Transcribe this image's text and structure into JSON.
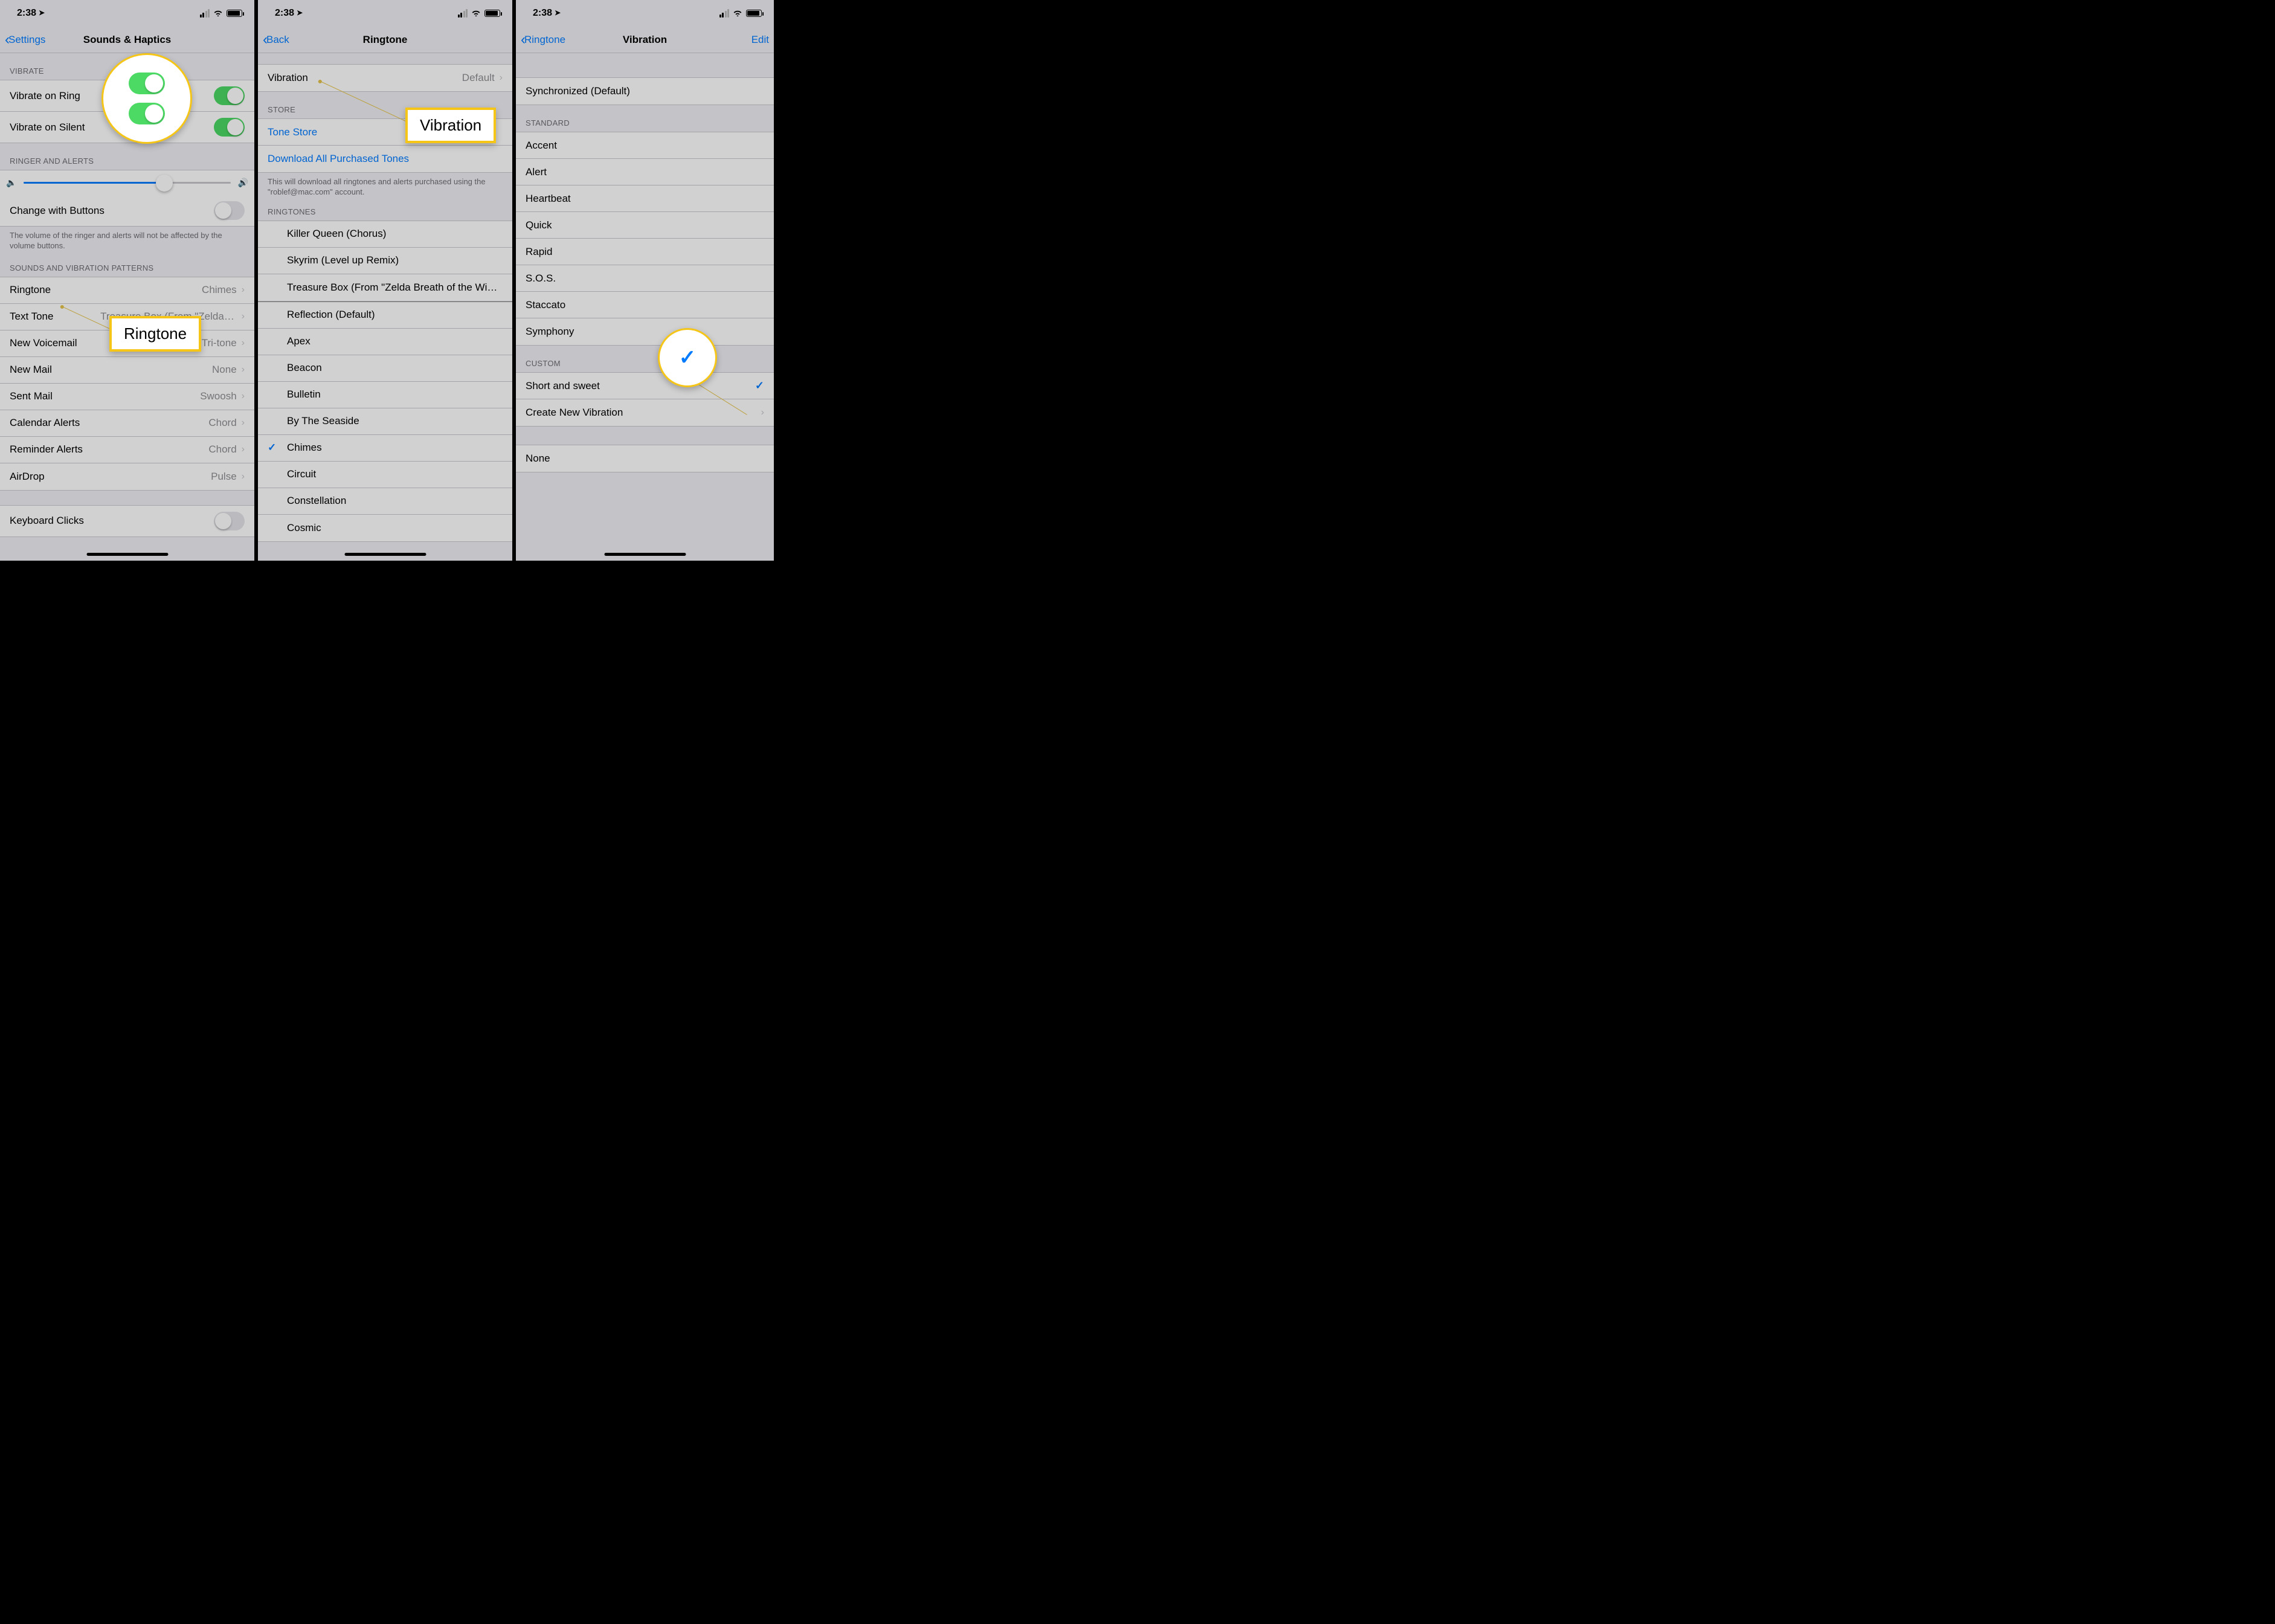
{
  "status": {
    "time": "2:38"
  },
  "screen1": {
    "back": "Settings",
    "title": "Sounds & Haptics",
    "sec_vibrate": "Vibrate",
    "vibrate_ring": "Vibrate on Ring",
    "vibrate_silent": "Vibrate on Silent",
    "sec_ringer": "Ringer and Alerts",
    "change_buttons": "Change with Buttons",
    "ringer_footer": "The volume of the ringer and alerts will not be affected by the volume buttons.",
    "sec_sounds": "Sounds and Vibration Patterns",
    "items": [
      {
        "label": "Ringtone",
        "detail": "Chimes"
      },
      {
        "label": "Text Tone",
        "detail": "Treasure Box (From \"Zelda Breath…"
      },
      {
        "label": "New Voicemail",
        "detail": "Tri-tone"
      },
      {
        "label": "New Mail",
        "detail": "None"
      },
      {
        "label": "Sent Mail",
        "detail": "Swoosh"
      },
      {
        "label": "Calendar Alerts",
        "detail": "Chord"
      },
      {
        "label": "Reminder Alerts",
        "detail": "Chord"
      },
      {
        "label": "AirDrop",
        "detail": "Pulse"
      }
    ],
    "keyboard_clicks": "Keyboard Clicks",
    "callout_label": "Ringtone"
  },
  "screen2": {
    "back": "Back",
    "title": "Ringtone",
    "vibration": "Vibration",
    "vibration_detail": "Default",
    "sec_store": "Store",
    "tone_store": "Tone Store",
    "download_all": "Download All Purchased Tones",
    "store_footer": "This will download all ringtones and alerts purchased using the \"roblef@mac.com\" account.",
    "sec_ringtones": "Ringtones",
    "custom_tones": [
      "Killer Queen (Chorus)",
      "Skyrim (Level up Remix)",
      "Treasure Box (From \"Zelda Breath of the Wi…"
    ],
    "builtin": [
      "Reflection (Default)",
      "Apex",
      "Beacon",
      "Bulletin",
      "By The Seaside",
      "Chimes",
      "Circuit",
      "Constellation",
      "Cosmic"
    ],
    "selected": "Chimes",
    "callout_label": "Vibration"
  },
  "screen3": {
    "back": "Ringtone",
    "title": "Vibration",
    "edit": "Edit",
    "sync": "Synchronized (Default)",
    "sec_standard": "Standard",
    "standard": [
      "Accent",
      "Alert",
      "Heartbeat",
      "Quick",
      "Rapid",
      "S.O.S.",
      "Staccato",
      "Symphony"
    ],
    "sec_custom": "Custom",
    "custom_item": "Short and sweet",
    "create_new": "Create New Vibration",
    "none": "None"
  }
}
